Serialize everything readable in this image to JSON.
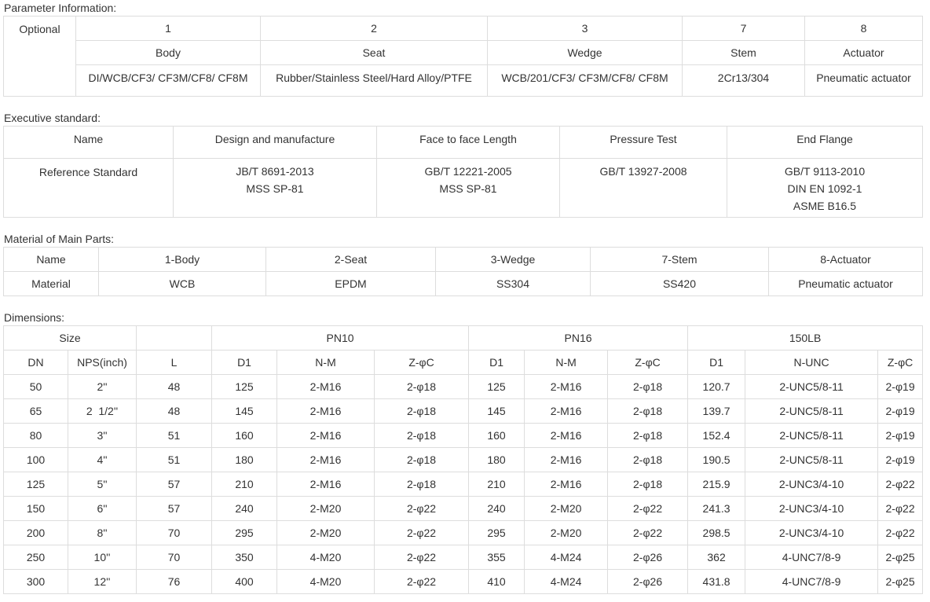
{
  "param": {
    "label": "Parameter Information:",
    "optional_label": "Optional",
    "numbers": [
      "1",
      "2",
      "3",
      "7",
      "8"
    ],
    "parts": [
      "Body",
      "Seat",
      "Wedge",
      "Stem",
      "Actuator"
    ],
    "materials": [
      "DI/WCB/CF3/ CF3M/CF8/ CF8M",
      "Rubber/Stainless Steel/Hard Alloy/PTFE",
      "WCB/201/CF3/ CF3M/CF8/ CF8M",
      "2Cr13/304",
      "Pneumatic actuator"
    ]
  },
  "exec": {
    "label": "Executive standard:",
    "headers": [
      "Name",
      "Design and manufacture",
      "Face to face Length",
      "Pressure Test",
      "End Flange"
    ],
    "row_name": "Reference Standard",
    "cells": [
      [
        "JB/T 8691-2013",
        "MSS SP-81"
      ],
      [
        "GB/T 12221-2005",
        "MSS SP-81"
      ],
      [
        "GB/T 13927-2008"
      ],
      [
        "GB/T 9113-2010",
        "DIN EN 1092-1",
        "ASME B16.5"
      ]
    ]
  },
  "material": {
    "label": "Material of Main Parts:",
    "headers": [
      "Name",
      "1-Body",
      "2-Seat",
      "3-Wedge",
      "7-Stem",
      "8-Actuator"
    ],
    "row": [
      "Material",
      "WCB",
      "EPDM",
      "SS304",
      "SS420",
      "Pneumatic actuator"
    ]
  },
  "dims": {
    "label": "Dimensions:",
    "group_headers": {
      "size": "Size",
      "pn10": "PN10",
      "pn16": "PN16",
      "lb150": "150LB"
    },
    "sub_headers": [
      "DN",
      "NPS(inch)",
      "L",
      "D1",
      "N-M",
      "Z-φC",
      "D1",
      "N-M",
      "Z-φC",
      "D1",
      "N-UNC",
      "Z-φC"
    ],
    "rows": [
      [
        "50",
        "2''",
        "48",
        "125",
        "2-M16",
        "2-φ18",
        "125",
        "2-M16",
        "2-φ18",
        "120.7",
        "2-UNC5/8-11",
        "2-φ19"
      ],
      [
        "65",
        "2  1/2''",
        "48",
        "145",
        "2-M16",
        "2-φ18",
        "145",
        "2-M16",
        "2-φ18",
        "139.7",
        "2-UNC5/8-11",
        "2-φ19"
      ],
      [
        "80",
        "3''",
        "51",
        "160",
        "2-M16",
        "2-φ18",
        "160",
        "2-M16",
        "2-φ18",
        "152.4",
        "2-UNC5/8-11",
        "2-φ19"
      ],
      [
        "100",
        "4''",
        "51",
        "180",
        "2-M16",
        "2-φ18",
        "180",
        "2-M16",
        "2-φ18",
        "190.5",
        "2-UNC5/8-11",
        "2-φ19"
      ],
      [
        "125",
        "5''",
        "57",
        "210",
        "2-M16",
        "2-φ18",
        "210",
        "2-M16",
        "2-φ18",
        "215.9",
        "2-UNC3/4-10",
        "2-φ22"
      ],
      [
        "150",
        "6''",
        "57",
        "240",
        "2-M20",
        "2-φ22",
        "240",
        "2-M20",
        "2-φ22",
        "241.3",
        "2-UNC3/4-10",
        "2-φ22"
      ],
      [
        "200",
        "8''",
        "70",
        "295",
        "2-M20",
        "2-φ22",
        "295",
        "2-M20",
        "2-φ22",
        "298.5",
        "2-UNC3/4-10",
        "2-φ22"
      ],
      [
        "250",
        "10''",
        "70",
        "350",
        "4-M20",
        "2-φ22",
        "355",
        "4-M24",
        "2-φ26",
        "362",
        "4-UNC7/8-9",
        "2-φ25"
      ],
      [
        "300",
        "12''",
        "76",
        "400",
        "4-M20",
        "2-φ22",
        "410",
        "4-M24",
        "2-φ26",
        "431.8",
        "4-UNC7/8-9",
        "2-φ25"
      ]
    ]
  }
}
